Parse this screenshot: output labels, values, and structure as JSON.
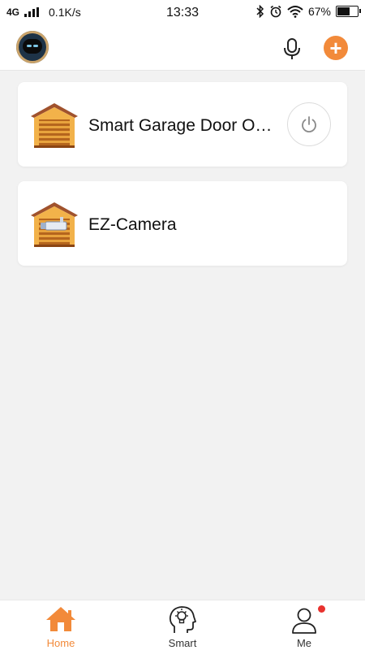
{
  "status_bar": {
    "network": "4G",
    "speed": "0.1K/s",
    "time": "13:33",
    "battery": "67%",
    "battery_level": 0.67
  },
  "header": {
    "avatar_icon": "robot-avatar-icon",
    "mic_icon": "microphone-icon",
    "add_icon": "plus-icon",
    "add_symbol": "+",
    "accent_color": "#f28a3a"
  },
  "devices": [
    {
      "name": "Smart Garage Door O…",
      "icon": "garage-icon",
      "has_power_button": true
    },
    {
      "name": "EZ-Camera",
      "icon": "garage-camera-icon",
      "has_power_button": false
    }
  ],
  "tabs": [
    {
      "label": "Home",
      "icon": "home-icon",
      "active": true
    },
    {
      "label": "Smart",
      "icon": "smart-brain-icon",
      "active": false
    },
    {
      "label": "Me",
      "icon": "person-icon",
      "active": false,
      "badge": true
    }
  ]
}
